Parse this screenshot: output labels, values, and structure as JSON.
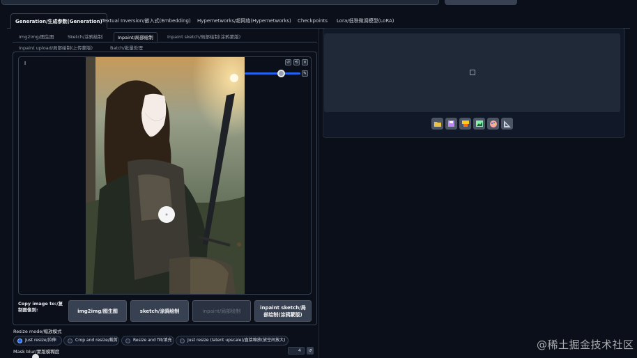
{
  "main_tabs": [
    {
      "label": "Generation/生成参数(Generation)",
      "active": true
    },
    {
      "label": "Textual Inversion/嵌入式(Embedding)",
      "active": false
    },
    {
      "label": "Hypernetworks/超网络(Hypernetworks)",
      "active": false
    },
    {
      "label": "Checkpoints",
      "active": false
    },
    {
      "label": "Lora/低秩微调模型(LoRA)",
      "active": false
    }
  ],
  "sub_tabs": [
    {
      "label": "img2img/图生图",
      "active": false
    },
    {
      "label": "Sketch/涂鸦绘制",
      "active": false
    },
    {
      "label": "Inpaint/局部绘制",
      "active": true
    },
    {
      "label": "Inpaint sketch/局部绘制(涂鸦蒙版)",
      "active": false
    },
    {
      "label": "Inpaint upload/局部绘制(上传蒙版)",
      "active": false
    },
    {
      "label": "Batch/批量处理",
      "active": false
    }
  ],
  "canvas": {
    "label": "I",
    "brush_size_fraction": 0.62
  },
  "copy_image": {
    "label": "Copy image to:/复制图像到:",
    "buttons": [
      {
        "label": "img2img/图生图",
        "enabled": true
      },
      {
        "label": "sketch/涂鸦绘制",
        "enabled": true
      },
      {
        "label": "inpaint/局部绘制",
        "enabled": false
      },
      {
        "label": "inpaint sketch/局部绘制(涂鸦蒙版)",
        "enabled": true
      }
    ]
  },
  "resize_mode": {
    "label": "Resize mode/缩放模式",
    "options": [
      {
        "label": "Just resize/拉伸",
        "selected": true
      },
      {
        "label": "Crop and resize/裁剪",
        "selected": false
      },
      {
        "label": "Resize and fill/填充",
        "selected": false
      },
      {
        "label": "Just resize (latent upscale)/直接缩放(放空间放大)",
        "selected": false
      }
    ]
  },
  "mask_blur": {
    "label": "Mask blur/蒙版模糊度",
    "value": "4"
  },
  "output_tools": [
    "folder-icon",
    "save-icon",
    "zip-icon",
    "send-to-img2img-icon",
    "send-to-inpaint-icon",
    "send-to-extras-icon"
  ],
  "watermark": "@稀土掘金技术社区",
  "colors": {
    "background": "#0b0f19",
    "accent": "#2563eb",
    "panel": "#1f2937"
  }
}
